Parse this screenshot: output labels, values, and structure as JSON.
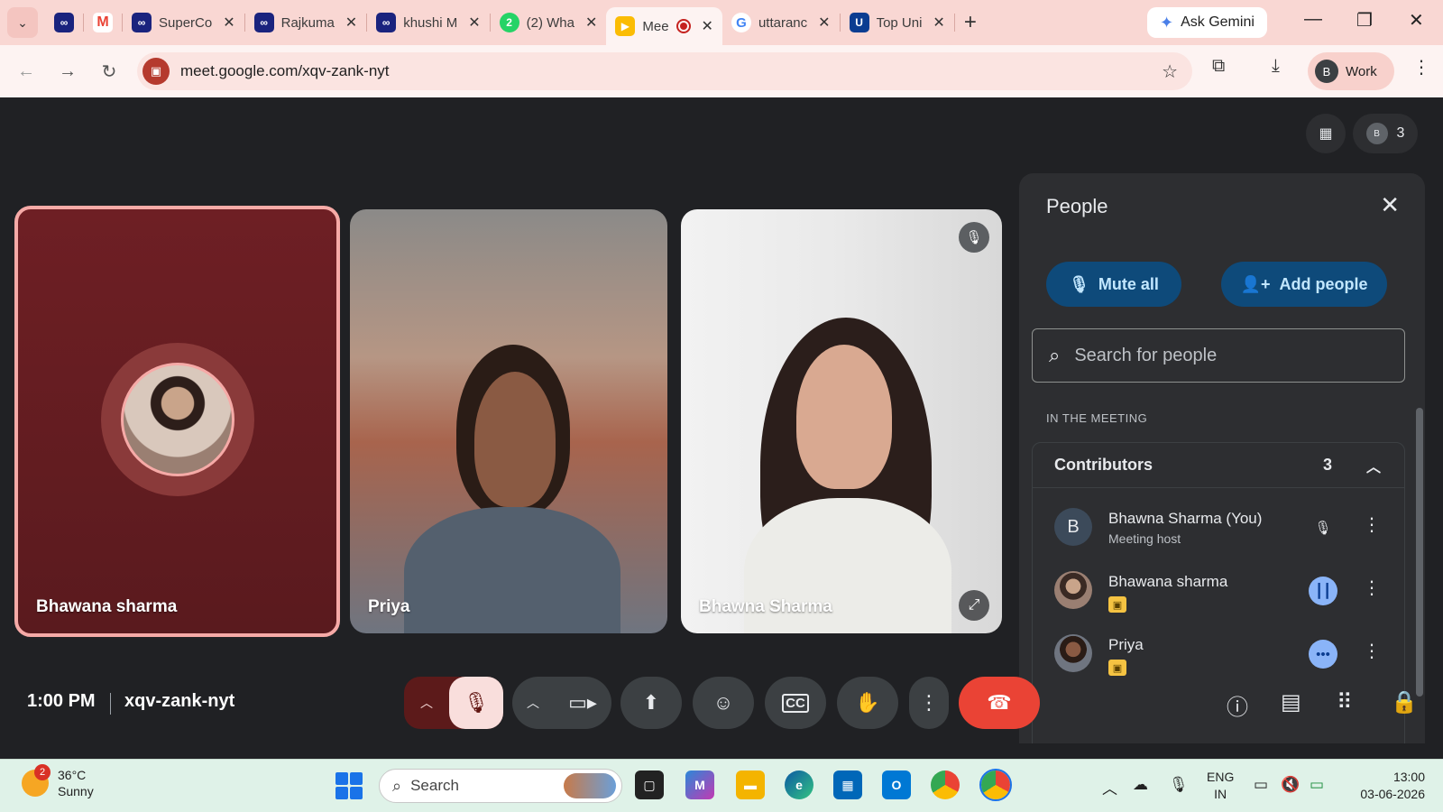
{
  "browser": {
    "tabs": [
      {
        "title": "",
        "icon": "infinity-icon",
        "color": "#1a237e",
        "active": false
      },
      {
        "title": "",
        "icon": "gmail-icon",
        "color": "#ea4335",
        "active": false
      },
      {
        "title": "SuperCo",
        "icon": "infinity-icon",
        "color": "#1a237e",
        "active": false
      },
      {
        "title": "Rajkuma",
        "icon": "infinity-icon",
        "color": "#1a237e",
        "active": false
      },
      {
        "title": "khushi M",
        "icon": "infinity-icon",
        "color": "#1a237e",
        "active": false
      },
      {
        "title": "(2) Wha",
        "icon": "whatsapp-icon",
        "color": "#25d366",
        "badge": "2",
        "active": false
      },
      {
        "title": "Mee",
        "icon": "meet-icon",
        "color": "#fbbc04",
        "active": true
      },
      {
        "title": "uttaranc",
        "icon": "google-icon",
        "color": "#4285f4",
        "active": false
      },
      {
        "title": "Top Uni",
        "icon": "university-icon",
        "color": "#0b3d91",
        "active": false
      }
    ],
    "gemini_label": "Ask Gemini",
    "url": "meet.google.com/xqv-zank-nyt",
    "profile_initial": "B",
    "profile_label": "Work"
  },
  "meet": {
    "participant_count": "3",
    "self_initial": "B",
    "tiles": [
      {
        "name": "Bhawana sharma"
      },
      {
        "name": "Priya"
      },
      {
        "name": "Bhawna Sharma"
      }
    ],
    "people_panel": {
      "title": "People",
      "mute_all_label": "Mute all",
      "add_people_label": "Add people",
      "search_placeholder": "Search for people",
      "section_heading": "IN THE MEETING",
      "group_title": "Contributors",
      "group_count": "3",
      "people": [
        {
          "name": "Bhawna Sharma (You)",
          "subtitle": "Meeting host",
          "initial": "B",
          "mic": "muted"
        },
        {
          "name": "Bhawana sharma",
          "subtitle": "",
          "initial": "",
          "mic": "speaking"
        },
        {
          "name": "Priya",
          "subtitle": "",
          "initial": "",
          "mic": "idle"
        }
      ]
    },
    "time": "1:00 PM",
    "meeting_code": "xqv-zank-nyt"
  },
  "taskbar": {
    "weather_badge": "2",
    "temperature": "36°C",
    "condition": "Sunny",
    "search_label": "Search",
    "lang_line1": "ENG",
    "lang_line2": "IN",
    "clock_time": "13:00",
    "clock_date": "03-06-2026",
    "colors": {
      "accent": "#1a73e8",
      "end_call": "#ea4335",
      "panel_button": "#0e4a7a"
    }
  }
}
